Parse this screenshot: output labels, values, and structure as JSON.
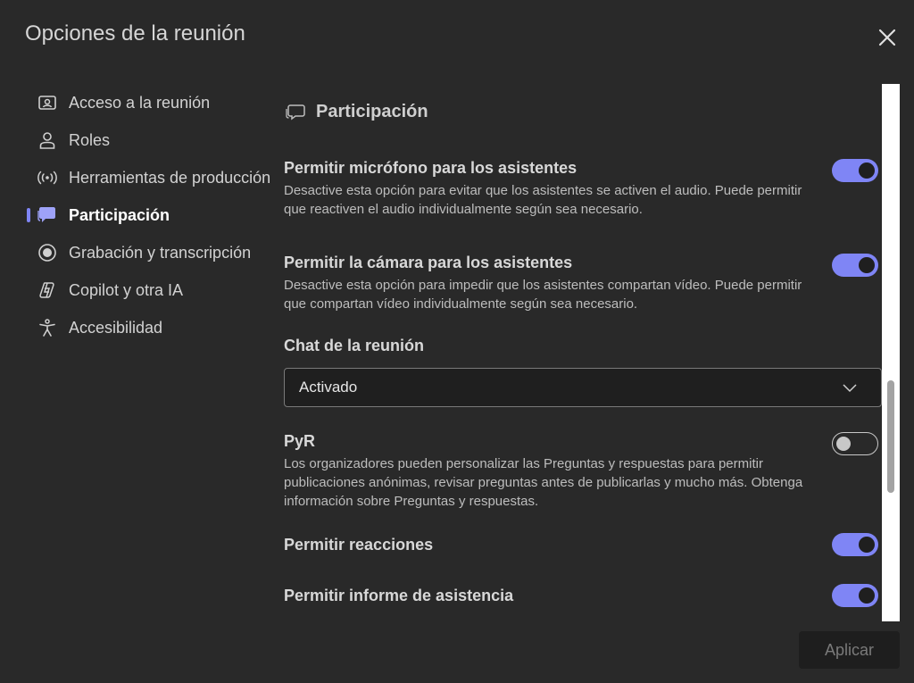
{
  "dialog": {
    "title": "Opciones de la reunión",
    "close_icon": "close-icon"
  },
  "sidebar": {
    "items": [
      {
        "label": "Acceso a la reunión",
        "icon": "meeting-access-icon",
        "active": false
      },
      {
        "label": "Roles",
        "icon": "person-icon",
        "active": false
      },
      {
        "label": "Herramientas de producción",
        "icon": "broadcast-icon",
        "active": false
      },
      {
        "label": "Participación",
        "icon": "chat-bubbles-icon",
        "active": true
      },
      {
        "label": "Grabación y transcripción",
        "icon": "record-icon",
        "active": false
      },
      {
        "label": "Copilot y otra IA",
        "icon": "copilot-icon",
        "active": false
      },
      {
        "label": "Accesibilidad",
        "icon": "accessibility-icon",
        "active": false
      }
    ]
  },
  "section": {
    "title": "Participación",
    "icon": "chat-bubbles-icon"
  },
  "settings": {
    "mic": {
      "name": "Permitir micrófono para los asistentes",
      "desc": "Desactive esta opción para evitar que los asistentes se activen el audio. Puede permitir que reactiven el audio individualmente según sea necesario.",
      "enabled": true
    },
    "camera": {
      "name": "Permitir la cámara para los asistentes",
      "desc": "Desactive esta opción para impedir que los asistentes compartan vídeo. Puede permitir que compartan vídeo individualmente según sea necesario.",
      "enabled": true
    },
    "chat": {
      "name": "Chat de la reunión",
      "selected": "Activado"
    },
    "qa": {
      "name": "PyR",
      "desc": "Los organizadores pueden personalizar las Preguntas y respuestas para permitir publicaciones anónimas, revisar preguntas antes de publicarlas y mucho más. Obtenga información sobre Preguntas y respuestas.",
      "enabled": false
    },
    "reactions": {
      "name": "Permitir reacciones",
      "enabled": true
    },
    "attendance": {
      "name": "Permitir informe de asistencia",
      "enabled": true
    }
  },
  "footer": {
    "apply_label": "Aplicar"
  },
  "colors": {
    "background": "#292929",
    "accent": "#7f85f5",
    "input_bg": "#1f1f1f"
  }
}
